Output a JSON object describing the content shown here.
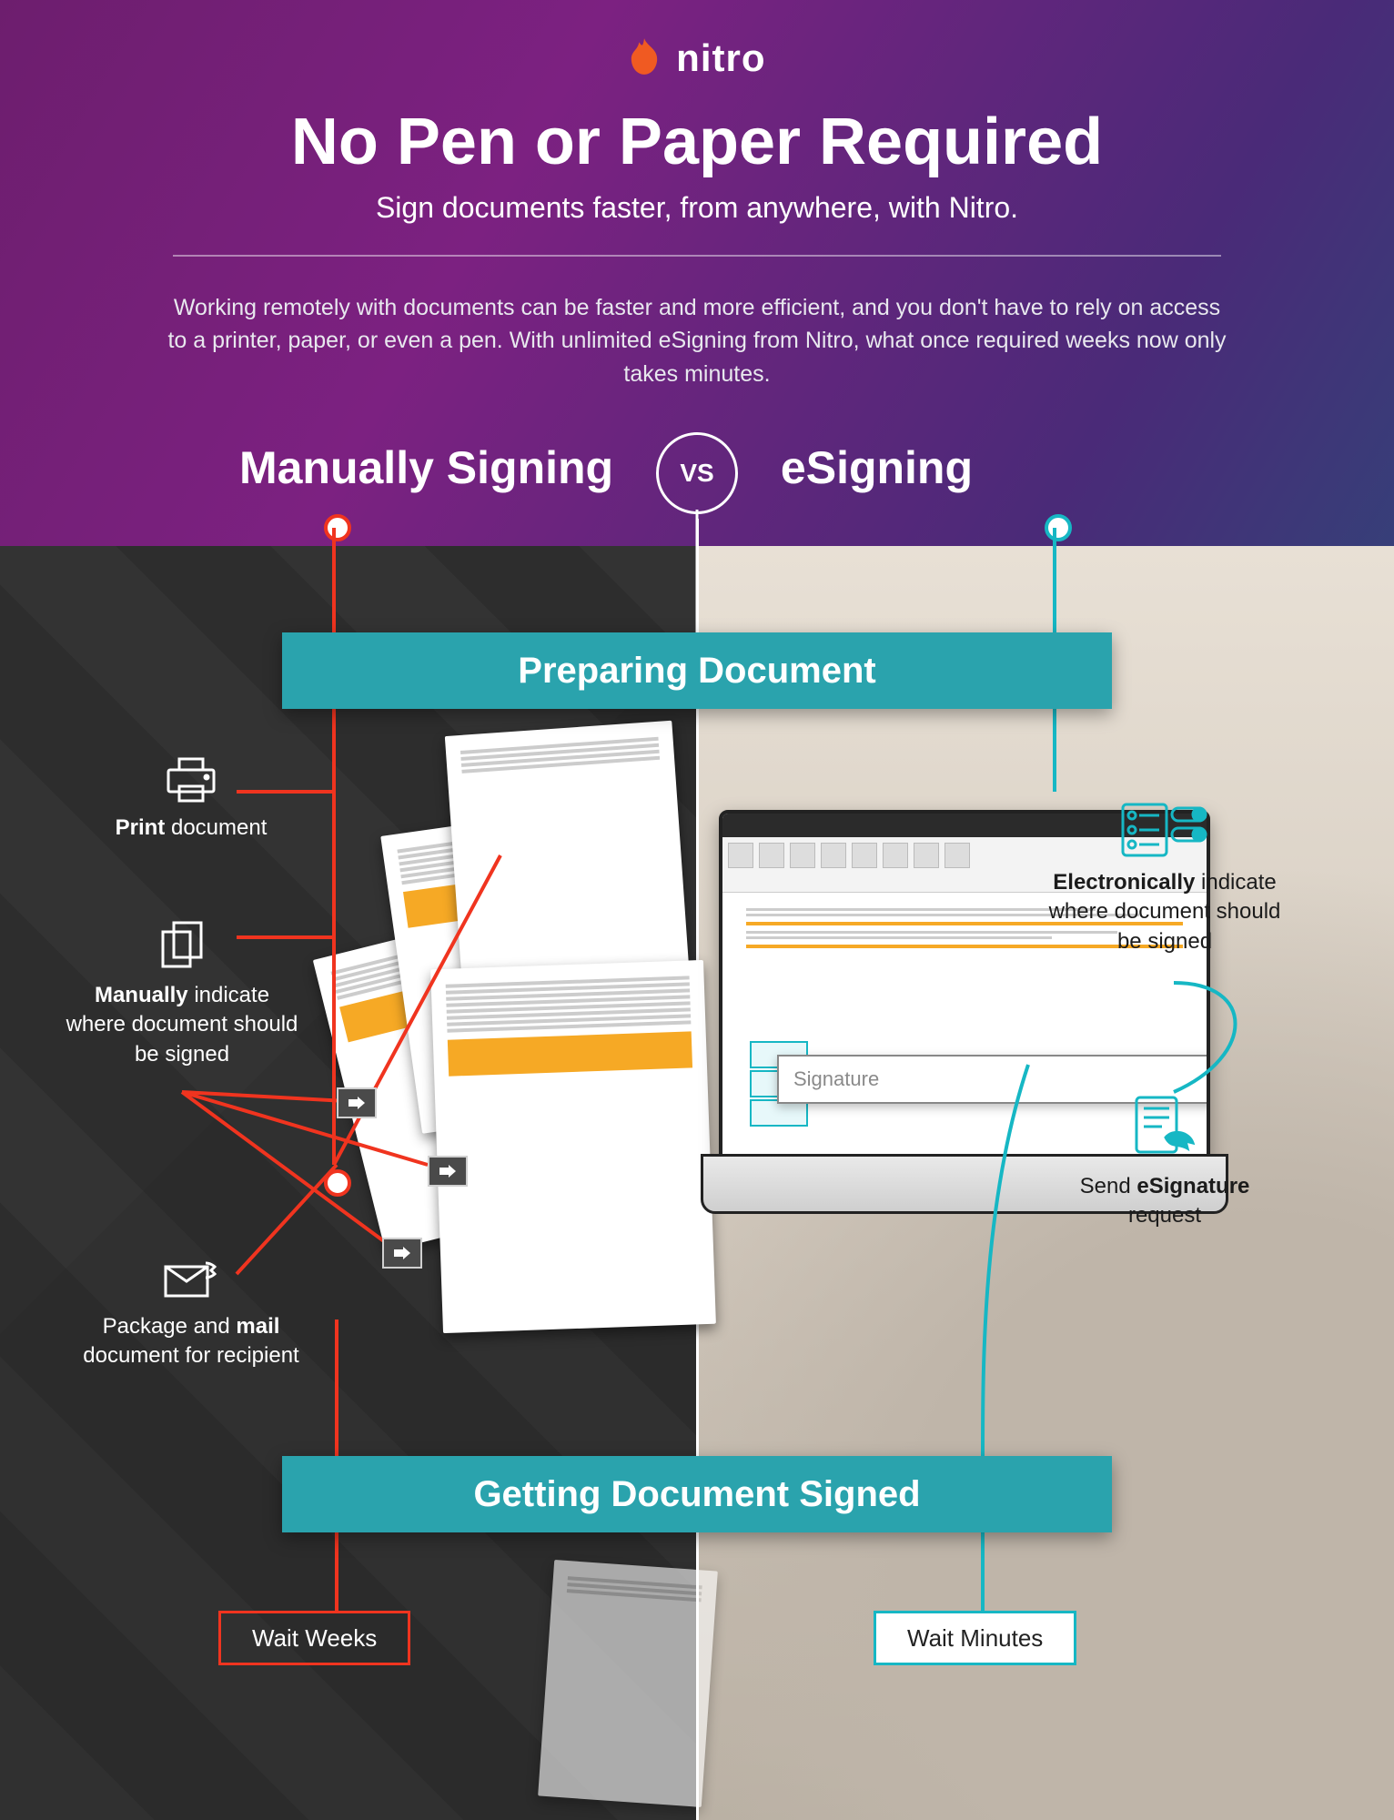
{
  "brand": "nitro",
  "title": "No Pen or Paper Required",
  "subtitle": "Sign documents faster, from anywhere, with Nitro.",
  "intro": "Working remotely with documents can be faster and more efficient, and you don't have to rely on access to a printer, paper, or even a pen.  With unlimited eSigning from Nitro, what once required weeks now only takes minutes.",
  "columns": {
    "left": "Manually Signing",
    "right": "eSigning",
    "vs": "VS"
  },
  "sections": {
    "prepare": "Preparing Document",
    "sign": "Getting Document Signed"
  },
  "manual": {
    "step1": {
      "bold": "Print",
      "rest": " document"
    },
    "step2": {
      "bold": "Manually",
      "rest": " indicate where document should be signed"
    },
    "step3": {
      "pre": "Package and ",
      "bold": "mail",
      "rest": " document for recipient"
    },
    "wait": "Wait Weeks"
  },
  "esign": {
    "step1": {
      "bold": "Electronically",
      "rest": " indicate where document should be signed"
    },
    "step2": {
      "pre": "Send ",
      "bold": "eSignature",
      "rest": " request"
    },
    "sig_placeholder": "Signature",
    "wait": "Wait Minutes"
  }
}
